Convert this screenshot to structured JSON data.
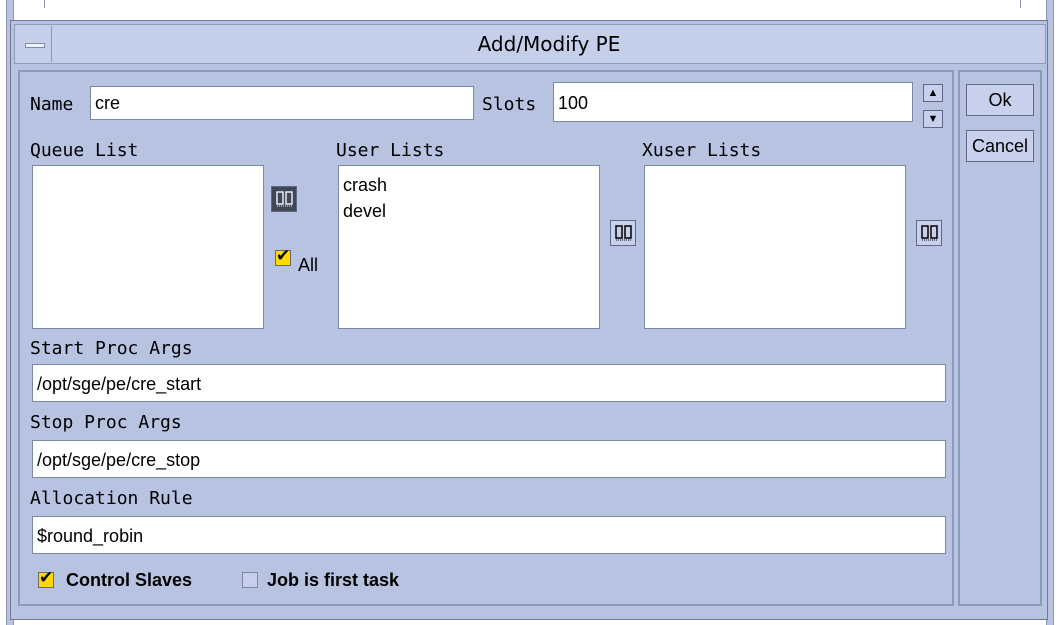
{
  "window": {
    "title": "Add/Modify PE"
  },
  "form": {
    "name_label": "Name",
    "name_value": "cre",
    "slots_label": "Slots",
    "slots_value": "100",
    "queue_list_label": "Queue List",
    "queue_list_items": [],
    "queue_all_label": "All",
    "queue_all_checked": true,
    "user_lists_label": "User Lists",
    "user_lists_items": [
      "crash",
      "devel"
    ],
    "xuser_lists_label": "Xuser Lists",
    "xuser_lists_items": [],
    "start_proc_label": "Start Proc Args",
    "start_proc_value": "/opt/sge/pe/cre_start",
    "stop_proc_label": "Stop Proc Args",
    "stop_proc_value": "/opt/sge/pe/cre_stop",
    "allocation_label": "Allocation Rule",
    "allocation_value": "$round_robin",
    "control_slaves_label": "Control Slaves",
    "control_slaves_checked": true,
    "job_first_task_label": "Job is first task",
    "job_first_task_checked": false
  },
  "buttons": {
    "ok": "Ok",
    "cancel": "Cancel"
  },
  "icons": {
    "window_menu": "window-menu-icon",
    "list_select": "list-select-icon",
    "spin_up": "arrow-up-icon",
    "spin_down": "arrow-down-icon",
    "checkmark": "checkmark-icon"
  },
  "colors": {
    "background": "#b8c3e2",
    "checkbox_checked": "#ffd800",
    "field": "#ffffff"
  }
}
